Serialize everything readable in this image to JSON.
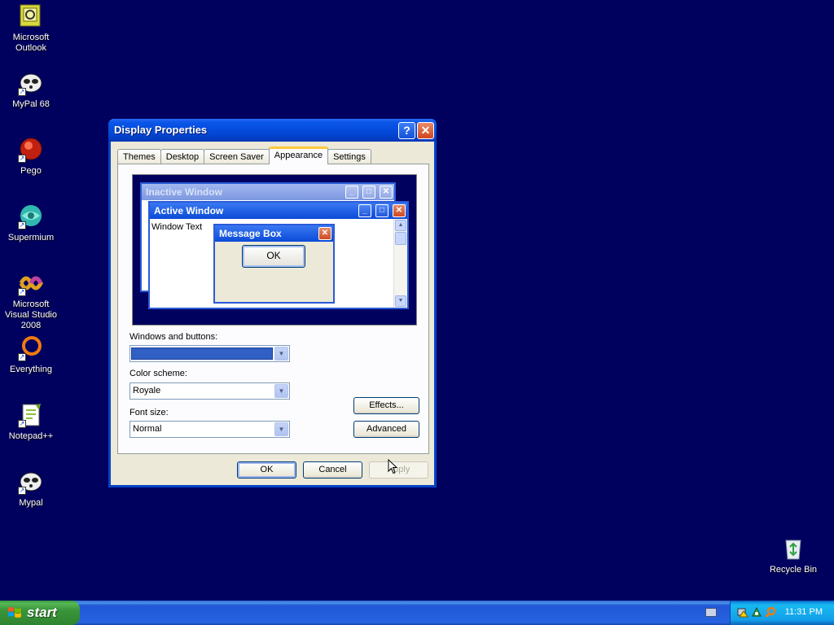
{
  "desktop": {
    "icons": [
      {
        "label": "Microsoft\nOutlook",
        "icon": "outlook-icon"
      },
      {
        "label": "MyPal 68",
        "icon": "mypal-icon"
      },
      {
        "label": "Pego",
        "icon": "pego-icon"
      },
      {
        "label": "Supermium",
        "icon": "supermium-icon"
      },
      {
        "label": "Microsoft Visual Studio 2008",
        "icon": "visual-studio-icon"
      },
      {
        "label": "Everything",
        "icon": "everything-icon"
      },
      {
        "label": "Notepad++",
        "icon": "notepadpp-icon"
      },
      {
        "label": "Mypal",
        "icon": "mypal-icon"
      },
      {
        "label": "Recycle Bin",
        "icon": "recycle-bin-icon"
      }
    ],
    "background_color": "#00005f"
  },
  "window": {
    "title": "Display Properties",
    "help_label": "?",
    "close_label": "✕",
    "tabs": [
      {
        "label": "Themes"
      },
      {
        "label": "Desktop"
      },
      {
        "label": "Screen Saver"
      },
      {
        "label": "Appearance"
      },
      {
        "label": "Settings"
      }
    ],
    "active_tab": "Appearance",
    "preview": {
      "inactive_title": "Inactive Window",
      "active_title": "Active Window",
      "window_text": "Window Text",
      "message_title": "Message Box",
      "message_ok": "OK"
    },
    "windows_and_buttons_label": "Windows and buttons:",
    "color_scheme_label": "Color scheme:",
    "color_scheme_value": "Royale",
    "font_size_label": "Font size:",
    "font_size_value": "Normal",
    "effects_label": "Effects...",
    "advanced_label": "Advanced",
    "ok_label": "OK",
    "cancel_label": "Cancel",
    "apply_label": "Apply"
  },
  "taskbar": {
    "start_label": "start",
    "clock": "11:31 PM"
  },
  "colors": {
    "titlebar": "#0349d8",
    "taskbar": "#2663e0",
    "start_button": "#3a943a",
    "tray": "#139ee9"
  }
}
